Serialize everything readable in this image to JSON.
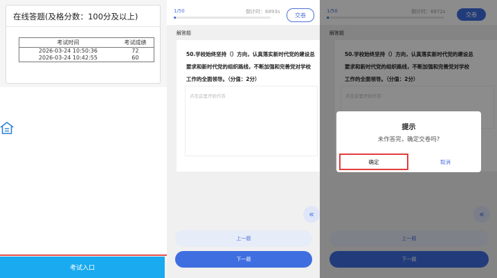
{
  "panel1": {
    "card_title": "在线答题(及格分数：100分及以上)",
    "table_headers": [
      "考试时间",
      "考试成绩"
    ],
    "rows": [
      {
        "time": "2026-03-24 10:50:36",
        "score": "72"
      },
      {
        "time": "2026-03-24 10:42:55",
        "score": "60"
      }
    ],
    "home_icon": "home-icon",
    "entry_button": "考试入口"
  },
  "panel2": {
    "progress": "1/50",
    "progress_fraction": 0.02,
    "timer": "倒计时：6893s",
    "submit": "交卷",
    "qtype": "解答题",
    "question": "50.学校始终坚持（）方向，认真落实新时代党的建设总要求和新时代党的组织路线，不断加强和完善党对学校工作的全面领导。（分值：2分）",
    "answer_placeholder": "点击这里开始作答",
    "collapse_icon": "«",
    "prev": "上一题",
    "next": "下一题"
  },
  "panel3": {
    "progress": "1/50",
    "progress_fraction": 0.02,
    "timer": "倒计时：6872s",
    "submit": "交卷",
    "qtype": "解答题",
    "question": "50.学校始终坚持（）方向，认真落实新时代党的建设总要求和新时代党的组织路线，不断加强和完善党对学校工作的全面领导。（分值：2分）",
    "answer_placeholder": "点击这里开始作答",
    "collapse_icon": "«",
    "prev": "上一题",
    "next": "下一题",
    "dialog": {
      "title": "提示",
      "message": "未作答完，确定交卷吗?",
      "confirm": "确定",
      "cancel": "取消"
    }
  },
  "colors": {
    "primary": "#3f6ee0",
    "entry_button": "#1aaaf0",
    "highlight": "#e33b3b"
  }
}
